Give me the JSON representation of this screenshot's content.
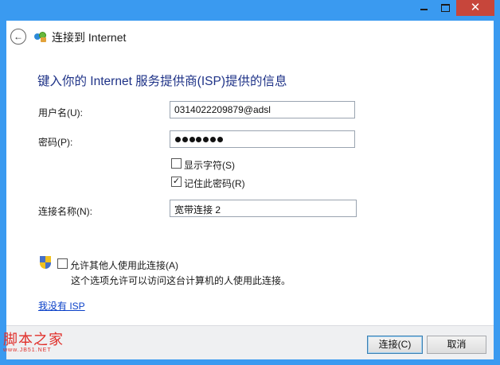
{
  "window": {
    "title": "连接到 Internet",
    "controls": {
      "minimize": "minimize",
      "maximize": "maximize",
      "close": "✕"
    }
  },
  "header": {
    "back_icon": "back-arrow-icon",
    "app_icon": "network-icon",
    "title": "连接到 Internet"
  },
  "main": {
    "heading": "键入你的 Internet 服务提供商(ISP)提供的信息",
    "username": {
      "label": "用户名(U):",
      "value": "0314022209879@adsl"
    },
    "password": {
      "label": "密码(P):",
      "dot_count": 7
    },
    "show_chars": {
      "label": "显示字符(S)",
      "checked": false
    },
    "remember_pw": {
      "label": "记住此密码(R)",
      "checked": true
    },
    "conn_name": {
      "label": "连接名称(N):",
      "value": "宽带连接 2"
    },
    "allow_others": {
      "label": "允许其他人使用此连接(A)",
      "checked": false,
      "description": "这个选项允许可以访问这台计算机的人使用此连接。"
    },
    "no_isp_link": "我没有 ISP"
  },
  "footer": {
    "connect_button": "连接(C)",
    "cancel_button": "取消"
  },
  "watermark": {
    "main": "脚本之家",
    "sub": "www.JB51.NET"
  },
  "colors": {
    "heading": "#1e3287",
    "link": "#0a40c8",
    "titlebar": "#3a9af0",
    "close": "#c7463b",
    "watermark": "#e02f2a"
  }
}
